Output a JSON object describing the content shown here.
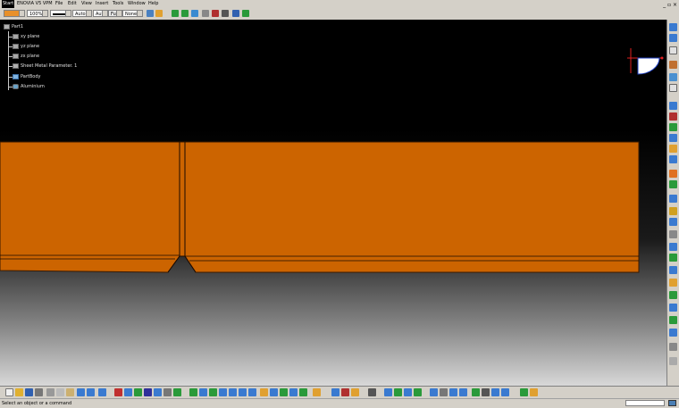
{
  "menu": {
    "start": "Start",
    "items": [
      "ENOVIA V5 VPM",
      "File",
      "Edit",
      "View",
      "Insert",
      "Tools",
      "Window",
      "Help"
    ]
  },
  "properties": {
    "color_box": "",
    "transparency": "100%",
    "linetype": "",
    "thickness": "Auto",
    "layer_a": "Aut",
    "layer_b": "Ful",
    "layer_c": "None"
  },
  "tree": {
    "root": "Part1",
    "children": [
      "xy plane",
      "yz plane",
      "zx plane",
      "Sheet Metal Parameter. 1",
      "PartBody",
      "Aluminium"
    ]
  },
  "status": {
    "message": "Select an object or a command"
  },
  "colors": {
    "part_fill": "#cc6400",
    "part_edge": "#1a0a00",
    "toolbar_bg": "#d4d0c8",
    "compass_red": "#e02020",
    "compass_blue": "#2040c0"
  }
}
